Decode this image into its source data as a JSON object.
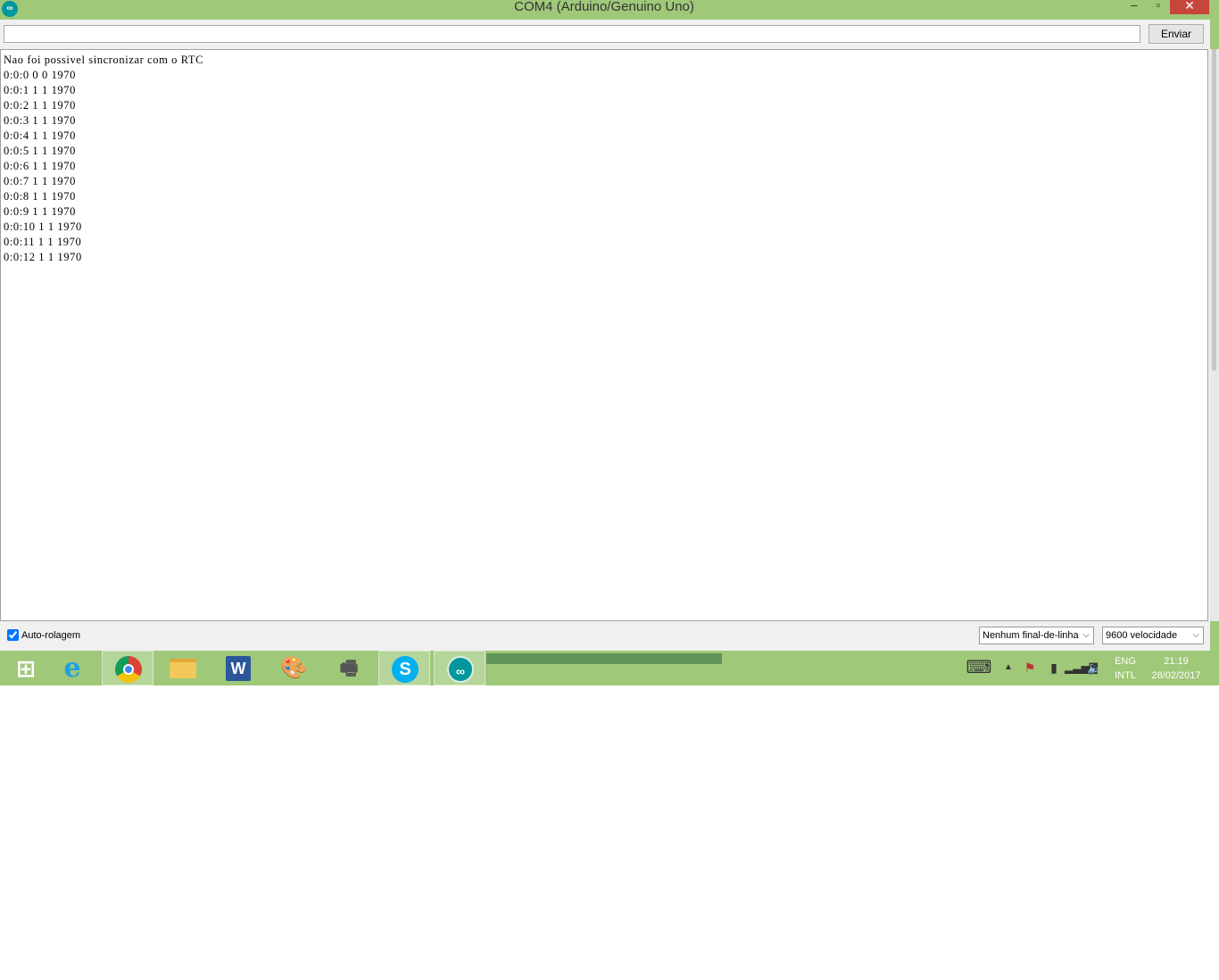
{
  "window": {
    "title": "COM4 (Arduino/Genuino Uno)",
    "app_icon": "∞",
    "controls": {
      "minimize": "–",
      "maximize": "▫",
      "close": "✕"
    }
  },
  "send": {
    "input_value": "",
    "button_label": "Enviar"
  },
  "serial": {
    "lines": [
      "Nao foi possivel sincronizar com o RTC",
      "0:0:0 0 0 1970",
      "0:0:1 1 1 1970",
      "0:0:2 1 1 1970",
      "0:0:3 1 1 1970",
      "0:0:4 1 1 1970",
      "0:0:5 1 1 1970",
      "0:0:6 1 1 1970",
      "0:0:7 1 1 1970",
      "0:0:8 1 1 1970",
      "0:0:9 1 1 1970",
      "0:0:10 1 1 1970",
      "0:0:11 1 1 1970",
      "0:0:12 1 1 1970"
    ]
  },
  "bottom_bar": {
    "autoscroll_label": "Auto-rolagem",
    "autoscroll_checked": true,
    "line_ending": "Nenhum final-de-linha",
    "baud_rate": "9600 velocidade"
  },
  "taskbar": {
    "apps": [
      {
        "name": "start",
        "glyph": "⊞"
      },
      {
        "name": "internet-explorer",
        "glyph": "e"
      },
      {
        "name": "chrome",
        "glyph": ""
      },
      {
        "name": "file-explorer",
        "glyph": ""
      },
      {
        "name": "word",
        "glyph": "W"
      },
      {
        "name": "paint",
        "glyph": "🎨"
      },
      {
        "name": "fax",
        "glyph": "🖷"
      },
      {
        "name": "skype",
        "glyph": "S"
      },
      {
        "name": "arduino",
        "glyph": "∞"
      }
    ],
    "tray": {
      "keyboard": "⌨",
      "arrow": "▲",
      "flag": "⚑",
      "battery": "▮",
      "signal": "▂▃▅▇",
      "volume": "🔈"
    },
    "language": "ENG",
    "layout": "INTL",
    "time": "21:19",
    "date": "28/02/2017"
  },
  "colors": {
    "accent": "#9fc879",
    "close": "#c7463c",
    "arduino": "#00979d"
  }
}
